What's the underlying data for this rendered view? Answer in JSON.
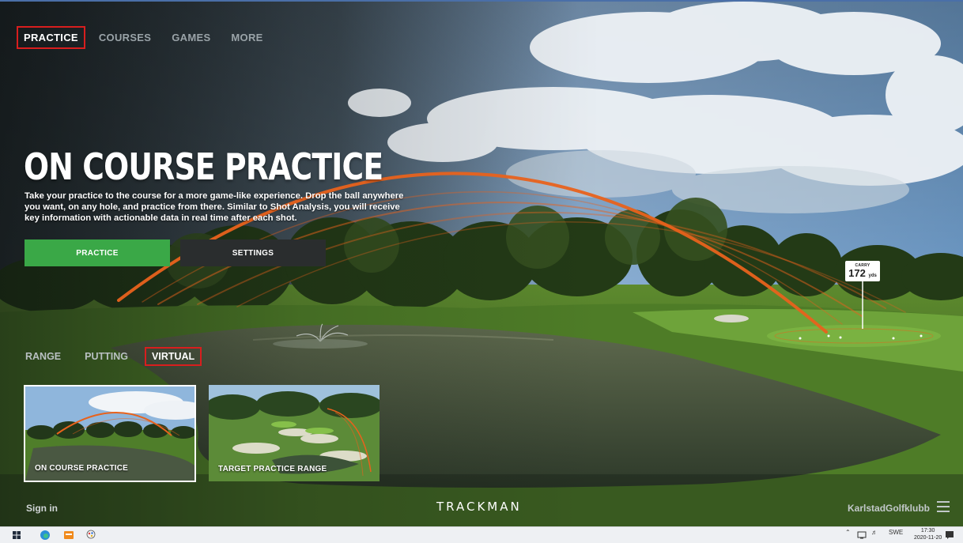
{
  "nav": {
    "items": [
      {
        "label": "PRACTICE",
        "active": true
      },
      {
        "label": "COURSES",
        "active": false
      },
      {
        "label": "GAMES",
        "active": false
      },
      {
        "label": "MORE",
        "active": false
      }
    ]
  },
  "hero": {
    "title": "ON COURSE PRACTICE",
    "description": "Take your practice to the course for a more game-like experience. Drop the ball anywhere you want, on any hole, and practice from there. Similar to Shot Analysis, you will receive key information with actionable data in real time after each shot.",
    "practice_button": "PRACTICE",
    "settings_button": "SETTINGS"
  },
  "carry": {
    "label": "CARRY",
    "value": "172",
    "unit": "yds"
  },
  "subtabs": {
    "items": [
      {
        "label": "RANGE",
        "active": false
      },
      {
        "label": "PUTTING",
        "active": false
      },
      {
        "label": "VIRTUAL",
        "active": true
      }
    ]
  },
  "cards": [
    {
      "label": "ON COURSE PRACTICE",
      "selected": true
    },
    {
      "label": "TARGET PRACTICE RANGE",
      "selected": false
    }
  ],
  "footer": {
    "sign_in": "Sign in",
    "logo": "TRACKMAN",
    "user": "KarlstadGolfklubb"
  },
  "taskbar": {
    "language": "SWE",
    "time": "17:30",
    "date": "2020-11-20"
  },
  "colors": {
    "accent_green": "#3aa847",
    "highlight_red": "#d81e1e",
    "shot_trace": "#e8621c"
  }
}
